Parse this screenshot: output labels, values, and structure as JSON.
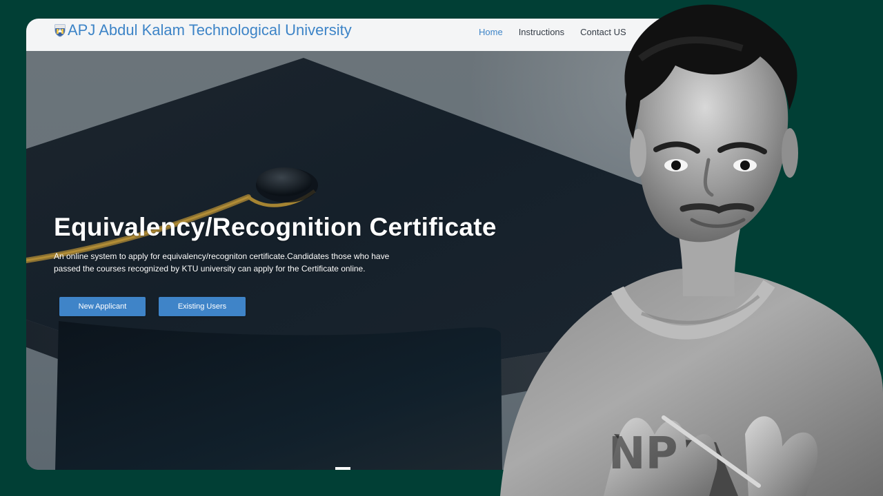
{
  "colors": {
    "background": "#013f35",
    "brand_blue": "#3d84c7",
    "button_blue": "#3f84c8",
    "hero_text": "#ffffff"
  },
  "header": {
    "university_name": "APJ Abdul Kalam Technological University",
    "logo_icon": "university-crest-icon",
    "nav": [
      {
        "label": "Home",
        "state": "active"
      },
      {
        "label": "Instructions"
      },
      {
        "label": "Contact US"
      }
    ]
  },
  "hero": {
    "title": "Equivalency/Recognition Certificate",
    "description": "An online system to apply for equivalency/recogniton certificate.Candidates those who have passed the courses recognized by KTU university can apply for the Certificate online.",
    "buttons": {
      "new_applicant": "New Applicant",
      "existing_users": "Existing Users"
    }
  },
  "overlay": {
    "presenter_visual": "person-cutout-image"
  }
}
